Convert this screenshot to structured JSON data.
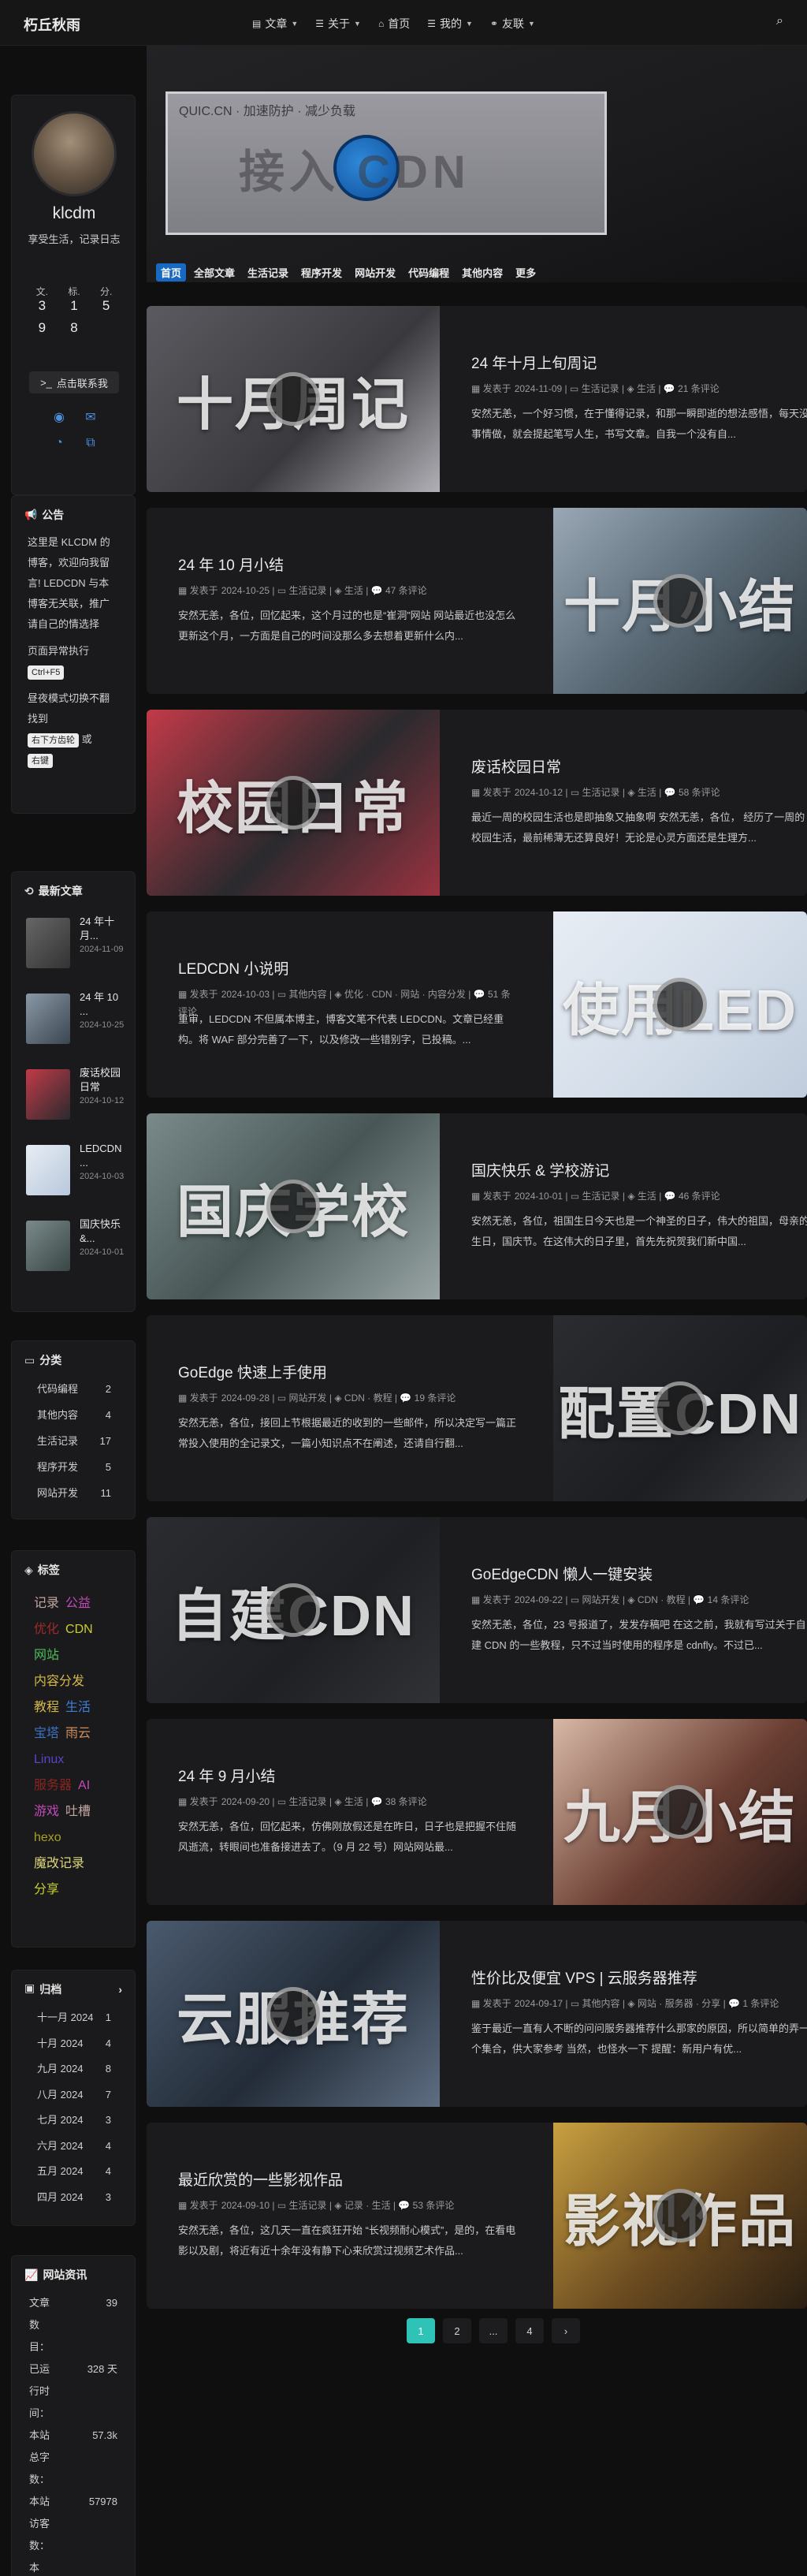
{
  "site": {
    "brand": "朽丘秋雨",
    "nav": [
      {
        "icon": "book-icon",
        "glyph": "▤",
        "label": "文章",
        "dropdown": true
      },
      {
        "icon": "list-icon",
        "glyph": "☰",
        "label": "关于",
        "dropdown": true
      },
      {
        "icon": "home-icon",
        "glyph": "⌂",
        "label": "首页",
        "dropdown": false
      },
      {
        "icon": "list-icon",
        "glyph": "☰",
        "label": "我的",
        "dropdown": true
      },
      {
        "icon": "link-icon",
        "glyph": "⚭",
        "label": "友联",
        "dropdown": true
      }
    ]
  },
  "hero": {
    "screenshot_title": "QUIC.CN · 加速防护 · 减少负载",
    "big_text": "接入  CDN"
  },
  "categories_bar": [
    {
      "label": "首页",
      "active": true
    },
    {
      "label": "全部文章",
      "active": false
    },
    {
      "label": "生活记录",
      "active": false
    },
    {
      "label": "程序开发",
      "active": false
    },
    {
      "label": "网站开发",
      "active": false
    },
    {
      "label": "代码编程",
      "active": false
    },
    {
      "label": "其他内容",
      "active": false
    },
    {
      "label": "更多",
      "active": false
    }
  ],
  "profile": {
    "name": "klcdm",
    "desc": "享受生活，记录日志",
    "stats": [
      {
        "label": "文.",
        "value": "3"
      },
      {
        "label": "标.",
        "value": "1"
      },
      {
        "label": "分.",
        "value": "5"
      },
      {
        "label": "",
        "value": "9"
      },
      {
        "label": "",
        "value": "8"
      },
      {
        "label": "",
        "value": ""
      }
    ],
    "link_button": "点击联系我",
    "social_icons": [
      "github-icon",
      "email-icon",
      "rss-icon",
      "sitemap-icon"
    ]
  },
  "notice": {
    "title": "公告",
    "text1": "这里是 KLCDM 的博客，欢迎向我留言! LEDCDN 与本博客无关联，推广请自己的情选择",
    "text2": "页面异常执行",
    "key1": "Ctrl+F5",
    "text3": "昼夜模式切换不翻找到",
    "key2": "右下方齿轮",
    "text4": "或",
    "key3": "右键"
  },
  "recent": {
    "title": "最新文章",
    "items": [
      {
        "title": "24 年十月...",
        "date": "2024-11-09"
      },
      {
        "title": "24 年 10 ...",
        "date": "2024-10-25"
      },
      {
        "title": "废话校园日常",
        "date": "2024-10-12"
      },
      {
        "title": "LEDCDN ...",
        "date": "2024-10-03"
      },
      {
        "title": "国庆快乐 &...",
        "date": "2024-10-01"
      }
    ]
  },
  "categories": {
    "title": "分类",
    "items": [
      {
        "name": "代码编程",
        "count": "2"
      },
      {
        "name": "其他内容",
        "count": "4"
      },
      {
        "name": "生活记录",
        "count": "17"
      },
      {
        "name": "程序开发",
        "count": "5"
      },
      {
        "name": "网站开发",
        "count": "11"
      }
    ]
  },
  "tags": {
    "title": "标签",
    "items": [
      {
        "label": "记录",
        "color": "#c2a6a0"
      },
      {
        "label": "公益",
        "color": "#c04bb8"
      },
      {
        "label": "优化",
        "color": "#a02a2a"
      },
      {
        "label": "CDN",
        "color": "#c8cf2c"
      },
      {
        "label": "网站",
        "color": "#4ebd5c"
      },
      {
        "label": "内容分发",
        "color": "#d4b84a"
      },
      {
        "label": "教程",
        "color": "#d4b84a"
      },
      {
        "label": "生活",
        "color": "#3f7fd8"
      },
      {
        "label": "宝塔",
        "color": "#3b72c4"
      },
      {
        "label": "雨云",
        "color": "#d08c5c"
      },
      {
        "label": "Linux",
        "color": "#5a44c8"
      },
      {
        "label": "服务器",
        "color": "#8a2420"
      },
      {
        "label": "AI",
        "color": "#c04bb8"
      },
      {
        "label": "游戏",
        "color": "#c04bb8"
      },
      {
        "label": "吐槽",
        "color": "#c2a6a0"
      },
      {
        "label": "hexo",
        "color": "#a8a020"
      },
      {
        "label": "魔改记录",
        "color": "#dcd67a"
      },
      {
        "label": "分享",
        "color": "#c8cf2c"
      }
    ]
  },
  "archive": {
    "title": "归档",
    "items": [
      {
        "month": "十一月 2024",
        "count": "1"
      },
      {
        "month": "十月 2024",
        "count": "4"
      },
      {
        "month": "九月 2024",
        "count": "8"
      },
      {
        "month": "八月 2024",
        "count": "7"
      },
      {
        "month": "七月 2024",
        "count": "3"
      },
      {
        "month": "六月 2024",
        "count": "4"
      },
      {
        "month": "五月 2024",
        "count": "4"
      },
      {
        "month": "四月 2024",
        "count": "3"
      }
    ]
  },
  "site_stats": {
    "title": "网站资讯",
    "items": [
      {
        "label": "文章数目：",
        "value": "39"
      },
      {
        "label": "已运行时间：",
        "value": "328 天"
      },
      {
        "label": "本站总字数：",
        "value": "57.3k"
      },
      {
        "label": "本站访客数：",
        "value": "57978"
      },
      {
        "label": "本",
        "value": ""
      }
    ]
  },
  "posts": [
    {
      "title": "24 年十月上旬周记",
      "date": "2024-11-09",
      "category": "生活记录",
      "tag": "生活",
      "comments": "21 条评论",
      "excerpt": "安然无恙，一个好习惯，在于懂得记录，和那一瞬即逝的想法感悟，每天没事情做，就会提起笔写人生，书写文章。自我一个没有自...",
      "thumb_text": "十月周记",
      "bg": "linear-gradient(135deg,#5a5a60,#3a3a3e 60%,#b0b0b6)",
      "image_left": true
    },
    {
      "title": "24 年 10 月小结",
      "date": "2024-10-25",
      "category": "生活记录",
      "tag": "生活",
      "comments": "47 条评论",
      "excerpt": "安然无恙，各位，回忆起来，这个月过的也是“崔洞”网站 网站最近也没怎么更新这个月，一方面是自己的时间没那么多去想着更新什么内...",
      "thumb_text": "十月小结",
      "bg": "linear-gradient(135deg,#9aa8b6,#5a6a76 50%,#303a40)",
      "image_left": false
    },
    {
      "title": "废话校园日常",
      "date": "2024-10-12",
      "category": "生活记录",
      "tag": "生活",
      "comments": "58 条评论",
      "excerpt": "最近一周的校园生活也是即抽象又抽象啊 安然无恙，各位， 经历了一周的校园生活，最前稀薄无还算良好！无论是心灵方面还是生理方...",
      "thumb_text": "校园日常",
      "bg": "linear-gradient(135deg,#c23a48,#2a2a2e 55%,#9a3240)",
      "image_left": true
    },
    {
      "title": "LEDCDN 小说明",
      "date": "2024-10-03",
      "category": "其他内容",
      "tag": "优化 · CDN · 网站 · 内容分发",
      "comments": "51 条评论",
      "excerpt": "重审，LEDCDN 不但属本博主，博客文笔不代表 LEDCDN。文章已经重构。将 WAF 部分完善了一下，以及修改一些错别字，已投稿。...",
      "thumb_text": "使用LED",
      "bg": "linear-gradient(135deg,#e8edf4,#d2dce8 60%,#c0ccdc)",
      "image_left": false
    },
    {
      "title": "国庆快乐 & 学校游记",
      "date": "2024-10-01",
      "category": "生活记录",
      "tag": "生活",
      "comments": "46 条评论",
      "excerpt": "安然无恙，各位，祖国生日今天也是一个神圣的日子，伟大的祖国，母亲的生日，国庆节。在这伟大的日子里，首先先祝贺我们新中国...",
      "thumb_text": "国庆学校",
      "bg": "linear-gradient(135deg,#7a8a8a,#485656 50%,#9aa6a6)",
      "image_left": true
    },
    {
      "title": "GoEdge 快速上手使用",
      "date": "2024-09-28",
      "category": "网站开发",
      "tag": "CDN · 教程",
      "comments": "19 条评论",
      "excerpt": "安然无恙，各位，接回上节根据最近的收到的一些邮件，所以决定写一篇正常投入使用的全记录文，一篇小知识点不在阐述，还请自行翻...",
      "thumb_text": "配置CDN",
      "bg": "linear-gradient(135deg,#2a2c30,#1c1e22 60%,#34363a)",
      "image_left": false
    },
    {
      "title": "GoEdgeCDN 懒人一键安装",
      "date": "2024-09-22",
      "category": "网站开发",
      "tag": "CDN · 教程",
      "comments": "14 条评论",
      "excerpt": "安然无恙，各位，23 号报道了，发发存稿吧 在这之前，我就有写过关于自建 CDN 的一些教程，只不过当时使用的程序是 cdnfly。不过已...",
      "thumb_text": "自建CDN",
      "bg": "linear-gradient(135deg,#2a2c30,#1e2024 60%,#303236)",
      "image_left": true
    },
    {
      "title": "24 年 9 月小结",
      "date": "2024-09-20",
      "category": "生活记录",
      "tag": "生活",
      "comments": "38 条评论",
      "excerpt": "安然无恙，各位，回忆起来，仿佛刚放假还是在昨日，日子也是把握不住随风逝流，转眼间也准备接进去了。（9 月 22 号）网站网站最...",
      "thumb_text": "九月小结",
      "bg": "linear-gradient(135deg,#d8b8a6,#6a3e32 55%,#2a1a18)",
      "image_left": false
    },
    {
      "title": "性价比及便宜 VPS | 云服务器推荐",
      "date": "2024-09-17",
      "category": "其他内容",
      "tag": "网站 · 服务器 · 分享",
      "comments": "1 条评论",
      "excerpt": "鉴于最近一直有人不断的问问服务器推荐什么那家的原因，所以简单的弄一个集合，供大家参考 当然，也怪水一下 提醒：新用户有优...",
      "thumb_text": "云服推荐",
      "bg": "linear-gradient(135deg,#4a5a6e,#232c38 55%,#5e6e82)",
      "image_left": true
    },
    {
      "title": "最近欣赏的一些影视作品",
      "date": "2024-09-10",
      "category": "生活记录",
      "tag": "记录 · 生活",
      "comments": "53 条评论",
      "excerpt": "安然无恙，各位，这几天一直在疯狂开始 “长视频耐心模式”，是的，在看电影以及剧，将近有近十余年没有静下心来欣赏过视频艺术作品...",
      "thumb_text": "影视作品",
      "bg": "linear-gradient(135deg,#c8a040,#6a4a20 55%,#2a1e12)",
      "image_left": false
    }
  ],
  "meta_labels": {
    "published": "发表于"
  },
  "pagination": [
    "1",
    "2",
    "...",
    "4",
    "›"
  ]
}
